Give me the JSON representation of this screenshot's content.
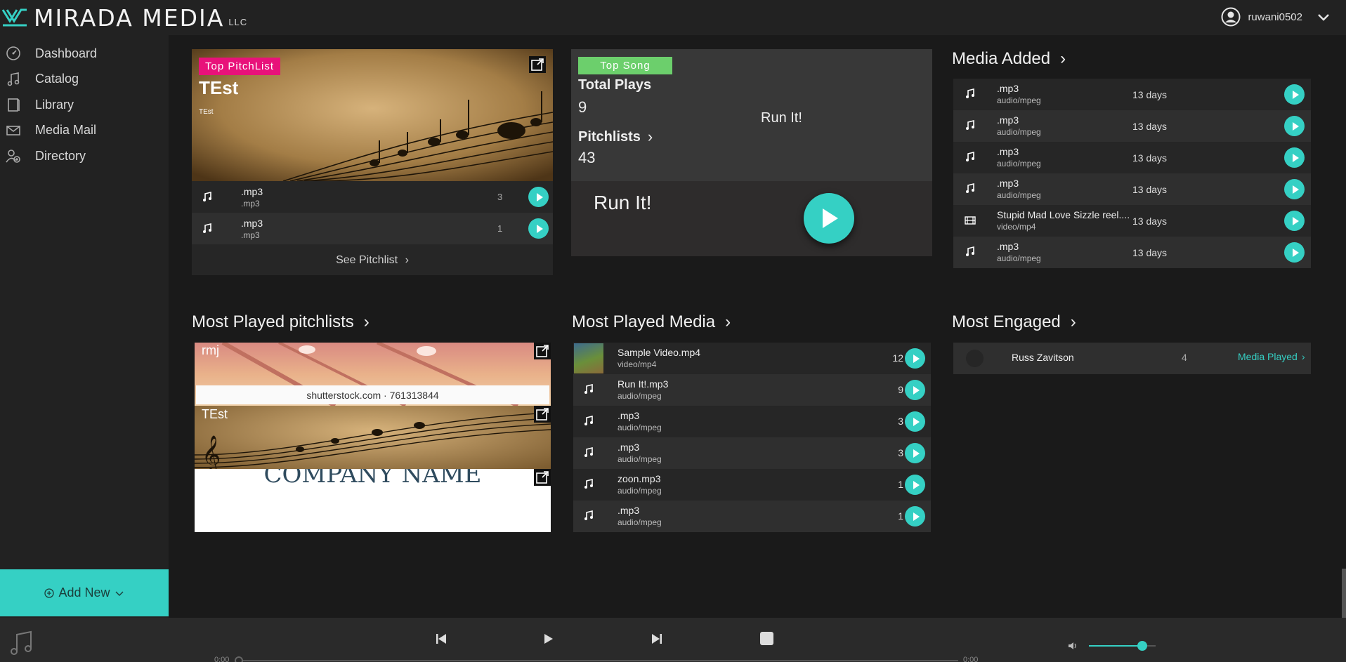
{
  "header": {
    "brand": "MIRADA MEDIA",
    "brand_suffix": "LLC",
    "username": "ruwani0502"
  },
  "sidebar": {
    "items": [
      {
        "label": "Dashboard",
        "icon": "dashboard-icon"
      },
      {
        "label": "Catalog",
        "icon": "music-note-icon"
      },
      {
        "label": "Library",
        "icon": "library-icon"
      },
      {
        "label": "Media Mail",
        "icon": "mail-icon"
      },
      {
        "label": "Directory",
        "icon": "directory-icon"
      }
    ],
    "add_new": "Add New"
  },
  "top_pitchlist": {
    "badge": "Top PitchList",
    "title": "TEst",
    "subtitle": "TEst",
    "rows": [
      {
        "name": ".mp3",
        "type": ".mp3",
        "count": "3"
      },
      {
        "name": ".mp3",
        "type": ".mp3",
        "count": "1"
      }
    ],
    "see_link": "See Pitchlist"
  },
  "top_song": {
    "badge": "Top Song",
    "total_plays_label": "Total Plays",
    "total_plays": "9",
    "pitchlists_label": "Pitchlists",
    "pitchlists": "43",
    "song_center": "Run It!",
    "song_title": "Run It!"
  },
  "media_added": {
    "title": "Media Added",
    "rows": [
      {
        "name": ".mp3",
        "type": "audio/mpeg",
        "age": "13 days",
        "icon": "music-note-icon"
      },
      {
        "name": ".mp3",
        "type": "audio/mpeg",
        "age": "13 days",
        "icon": "music-note-icon"
      },
      {
        "name": ".mp3",
        "type": "audio/mpeg",
        "age": "13 days",
        "icon": "music-note-icon"
      },
      {
        "name": ".mp3",
        "type": "audio/mpeg",
        "age": "13 days",
        "icon": "music-note-icon"
      },
      {
        "name": "Stupid Mad Love Sizzle reel....",
        "type": "video/mp4",
        "age": "13 days",
        "icon": "film-icon"
      },
      {
        "name": ".mp3",
        "type": "audio/mpeg",
        "age": "13 days",
        "icon": "music-note-icon"
      }
    ]
  },
  "most_played_pitchlists": {
    "title": "Most Played pitchlists",
    "items": [
      {
        "name": "rmj",
        "watermark": "shutterstock.com · 761313844"
      },
      {
        "name": "TEst"
      },
      {
        "name": "",
        "image_text": "COMPANY NAME"
      }
    ]
  },
  "most_played_media": {
    "title": "Most Played Media",
    "rows": [
      {
        "name": "Sample Video.mp4",
        "type": "video/mp4",
        "count": "12"
      },
      {
        "name": "Run It!.mp3",
        "type": "audio/mpeg",
        "count": "9"
      },
      {
        "name": ".mp3",
        "type": "audio/mpeg",
        "count": "3"
      },
      {
        "name": ".mp3",
        "type": "audio/mpeg",
        "count": "3"
      },
      {
        "name": "zoon.mp3",
        "type": "audio/mpeg",
        "count": "1"
      },
      {
        "name": ".mp3",
        "type": "audio/mpeg",
        "count": "1"
      }
    ]
  },
  "most_engaged": {
    "title": "Most Engaged",
    "rows": [
      {
        "name": "Russ Zavitson",
        "count": "4",
        "action": "Media Played"
      }
    ]
  },
  "player": {
    "time_start": "0:00",
    "time_end": "0:00",
    "volume": 0.8
  },
  "colors": {
    "accent": "#35d0c4",
    "pink_badge": "#e8127a",
    "green_badge": "#6ccf6c"
  }
}
